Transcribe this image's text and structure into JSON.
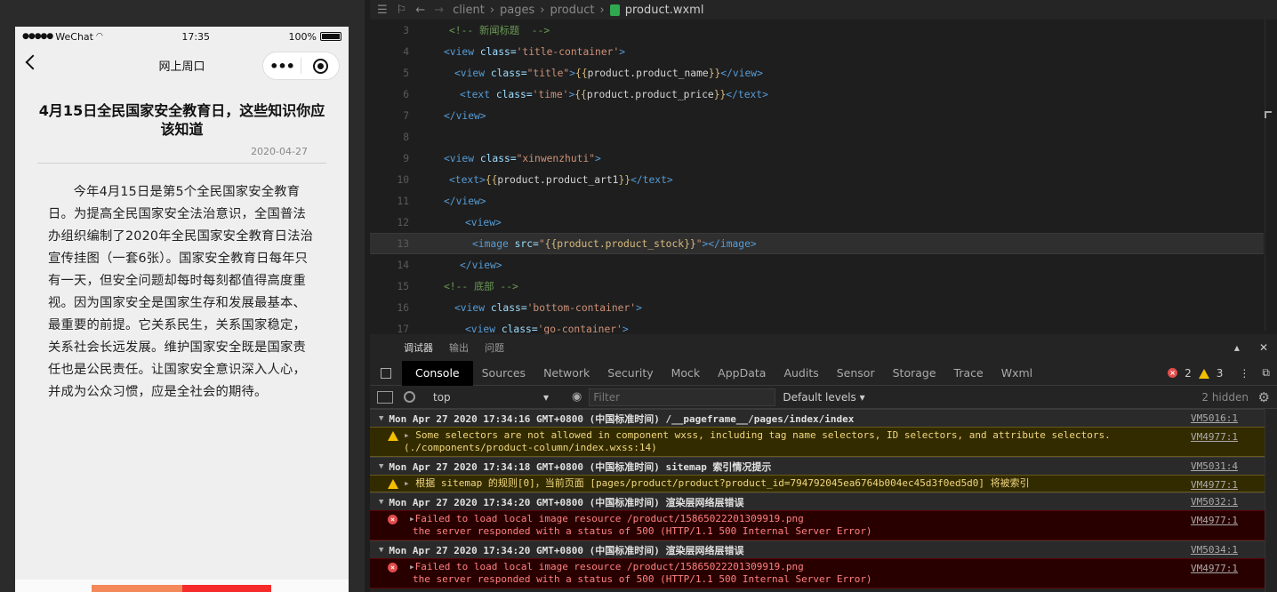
{
  "simulator": {
    "status": {
      "carrier": "WeChat",
      "time": "17:35",
      "battery": "100%",
      "battery_level": 1.0
    },
    "nav_title": "网上周口",
    "article": {
      "title": "4月15日全民国家安全教育日，这些知识你应该知道",
      "date": "2020-04-27",
      "body": "今年4月15日是第5个全民国家安全教育日。为提高全民国家安全法治意识，全国普法办组织编制了2020年全民国家安全教育日法治宣传挂图（一套6张）。国家安全教育日每年只有一天，但安全问题却每时每刻都值得高度重视。因为国家安全是国家生存和发展最基本、最重要的前提。它关系民生，关系国家稳定，关系社会长远发展。维护国家安全既是国家责任也是公民责任。让国家安全意识深入人心，并成为公众习惯，应是全社会的期待。"
    }
  },
  "editor": {
    "breadcrumb": [
      "client",
      "pages",
      "product",
      "product.wxml"
    ],
    "lines": [
      {
        "n": "3",
        "indent": 20,
        "parts": [
          {
            "c": "t-cm",
            "t": "<!-- 新闻标题  -->"
          }
        ]
      },
      {
        "n": "4",
        "indent": 14,
        "parts": [
          {
            "c": "t-tag",
            "t": "<view"
          },
          {
            "c": "t-attr",
            "t": " class="
          },
          {
            "c": "t-str",
            "t": "'title-container'"
          },
          {
            "c": "t-tag",
            "t": ">"
          }
        ]
      },
      {
        "n": "5",
        "indent": 26,
        "parts": [
          {
            "c": "t-tag",
            "t": "<view"
          },
          {
            "c": "t-attr",
            "t": " class="
          },
          {
            "c": "t-str",
            "t": "\"title\""
          },
          {
            "c": "t-tag",
            "t": ">"
          },
          {
            "c": "t-br",
            "t": "{{"
          },
          {
            "c": "t-txt",
            "t": "product.product_name"
          },
          {
            "c": "t-br",
            "t": "}}"
          },
          {
            "c": "t-tag",
            "t": "</view>"
          }
        ]
      },
      {
        "n": "6",
        "indent": 32,
        "parts": [
          {
            "c": "t-tag",
            "t": "<text"
          },
          {
            "c": "t-attr",
            "t": " class="
          },
          {
            "c": "t-str",
            "t": "'time'"
          },
          {
            "c": "t-tag",
            "t": ">"
          },
          {
            "c": "t-br",
            "t": "{{"
          },
          {
            "c": "t-txt",
            "t": "product.product_price"
          },
          {
            "c": "t-br",
            "t": "}}"
          },
          {
            "c": "t-tag",
            "t": "</text>"
          }
        ]
      },
      {
        "n": "7",
        "indent": 14,
        "parts": [
          {
            "c": "t-tag",
            "t": "</view>"
          }
        ]
      },
      {
        "n": "8",
        "indent": 14,
        "parts": []
      },
      {
        "n": "9",
        "indent": 14,
        "parts": [
          {
            "c": "t-tag",
            "t": "<view"
          },
          {
            "c": "t-attr",
            "t": " class="
          },
          {
            "c": "t-str",
            "t": "\"xinwenzhuti\""
          },
          {
            "c": "t-tag",
            "t": ">"
          }
        ]
      },
      {
        "n": "10",
        "indent": 20,
        "parts": [
          {
            "c": "t-tag",
            "t": "<text>"
          },
          {
            "c": "t-br",
            "t": "{{"
          },
          {
            "c": "t-txt",
            "t": "product.product_art1"
          },
          {
            "c": "t-br",
            "t": "}}"
          },
          {
            "c": "t-tag",
            "t": "</text>"
          }
        ]
      },
      {
        "n": "11",
        "indent": 14,
        "parts": [
          {
            "c": "t-tag",
            "t": "</view>"
          }
        ]
      },
      {
        "n": "12",
        "indent": 38,
        "parts": [
          {
            "c": "t-tag",
            "t": "<view>"
          }
        ]
      },
      {
        "n": "13",
        "indent": 46,
        "hl": true,
        "parts": [
          {
            "c": "t-tag",
            "t": "<image"
          },
          {
            "c": "t-attr",
            "t": " src="
          },
          {
            "c": "t-str",
            "t": "\""
          },
          {
            "c": "t-br",
            "t": "{{product.product_stock}}"
          },
          {
            "c": "t-str",
            "t": "\""
          },
          {
            "c": "t-tag",
            "t": "></image>"
          }
        ]
      },
      {
        "n": "14",
        "indent": 32,
        "parts": [
          {
            "c": "t-tag",
            "t": "</view>"
          }
        ]
      },
      {
        "n": "15",
        "indent": 14,
        "parts": [
          {
            "c": "t-cm",
            "t": "<!-- 底部 -->"
          }
        ]
      },
      {
        "n": "16",
        "indent": 26,
        "parts": [
          {
            "c": "t-tag",
            "t": "<view"
          },
          {
            "c": "t-attr",
            "t": " class="
          },
          {
            "c": "t-str",
            "t": "'bottom-container'"
          },
          {
            "c": "t-tag",
            "t": ">"
          }
        ]
      },
      {
        "n": "17",
        "indent": 38,
        "parts": [
          {
            "c": "t-tag",
            "t": "<view"
          },
          {
            "c": "t-attr",
            "t": " class="
          },
          {
            "c": "t-str",
            "t": "'go-container'"
          },
          {
            "c": "t-tag",
            "t": ">"
          }
        ]
      }
    ]
  },
  "devtools": {
    "panel_tabs": [
      "调试器",
      "输出",
      "问题"
    ],
    "tabs": [
      "Console",
      "Sources",
      "Network",
      "Security",
      "Mock",
      "AppData",
      "Audits",
      "Sensor",
      "Storage",
      "Trace",
      "Wxml"
    ],
    "error_count": "2",
    "warning_count": "3",
    "context": "top",
    "filter_placeholder": "Filter",
    "levels": "Default levels ▾",
    "hidden": "2 hidden",
    "logs": [
      {
        "kind": "group",
        "text": "Mon Apr 27 2020 17:34:16 GMT+0800 (中国标准时间) /__pageframe__/pages/index/index",
        "src": "VM5016:1"
      },
      {
        "kind": "warn",
        "text": "Some selectors are not allowed in component wxss, including tag name selectors, ID selectors, and attribute selectors.(./components/product-column/index.wxss:14)",
        "src": "VM4977:1"
      },
      {
        "kind": "group",
        "text": "Mon Apr 27 2020 17:34:18 GMT+0800 (中国标准时间) sitemap 索引情况提示",
        "src": "VM5031:4"
      },
      {
        "kind": "warn",
        "text": "根据 sitemap 的规则[0]，当前页面 [pages/product/product?product_id=794792045ea6764b004ec45d3f0ed5d0] 将被索引",
        "src": "VM4977:1"
      },
      {
        "kind": "group",
        "text": "Mon Apr 27 2020 17:34:20 GMT+0800 (中国标准时间) 渲染层网络层错误",
        "src": "VM5032:1"
      },
      {
        "kind": "err",
        "text": "Failed to load local image resource /product/15865022201309919.png",
        "text2": "the server responded with a status of 500 (HTTP/1.1 500 Internal Server Error)",
        "src": "VM4977:1"
      },
      {
        "kind": "group",
        "text": "Mon Apr 27 2020 17:34:20 GMT+0800 (中国标准时间) 渲染层网络层错误",
        "src": "VM5034:1"
      },
      {
        "kind": "err",
        "text": "Failed to load local image resource /product/15865022201309919.png",
        "text2": "the server responded with a status of 500 (HTTP/1.1 500 Internal Server Error)",
        "src": "VM4977:1"
      }
    ]
  }
}
